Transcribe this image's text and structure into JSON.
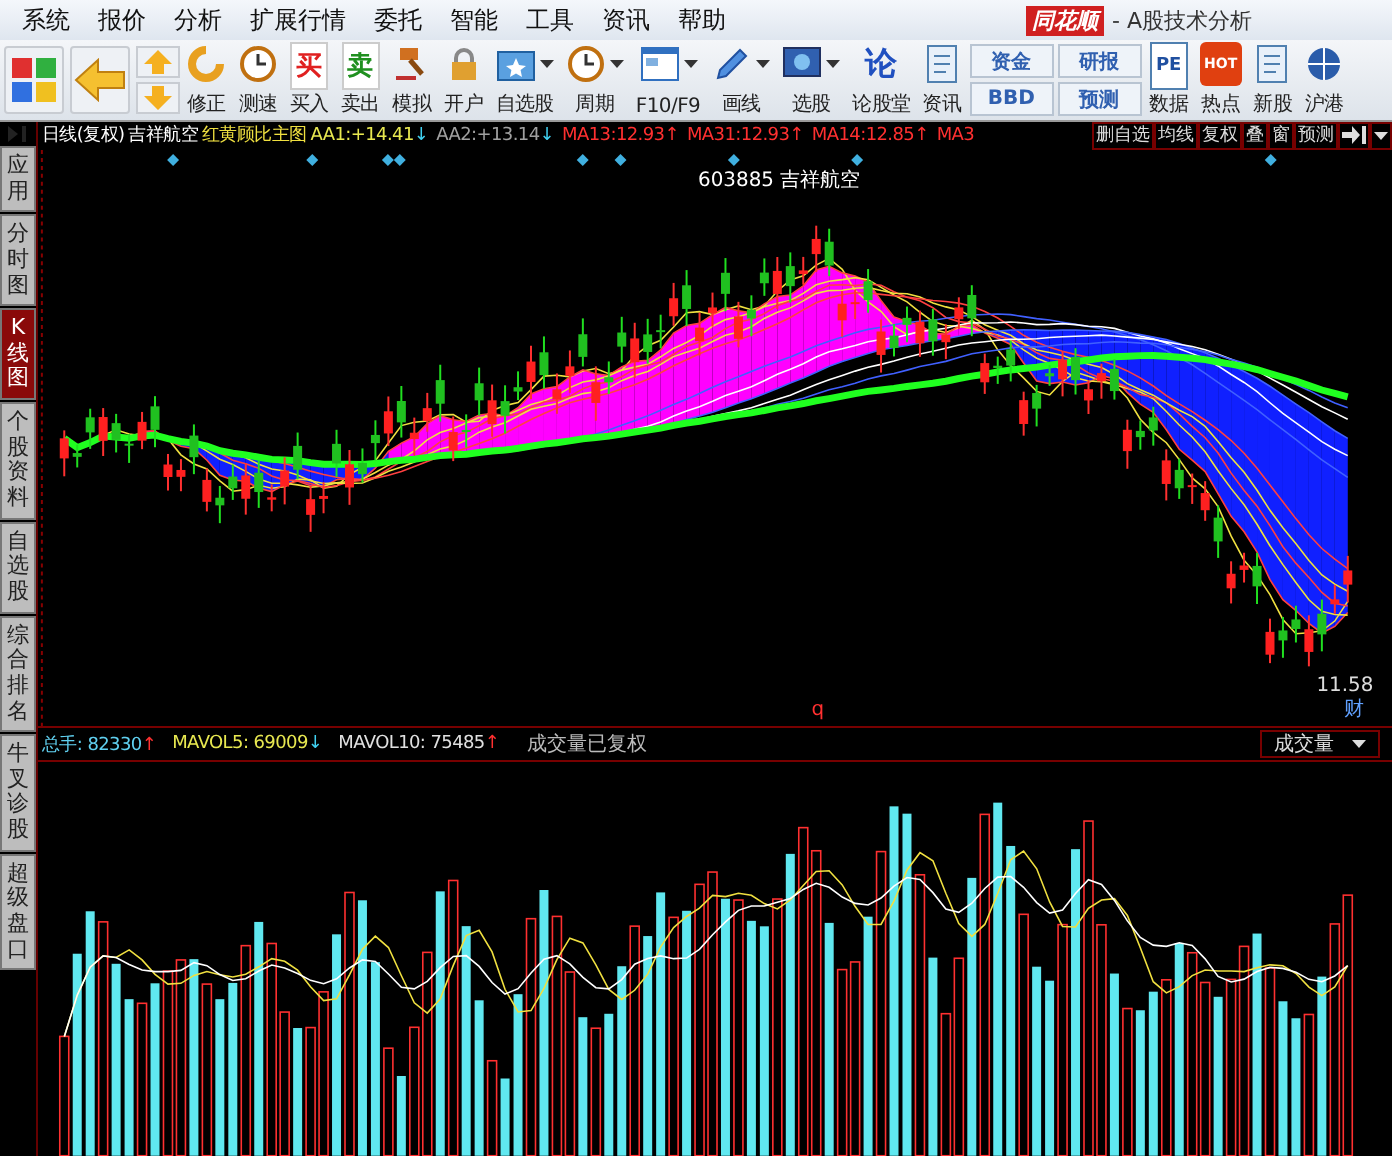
{
  "menu": [
    "系统",
    "报价",
    "分析",
    "扩展行情",
    "委托",
    "智能",
    "工具",
    "资讯",
    "帮助"
  ],
  "title": {
    "logo": "同花顺",
    "subtitle": "- A股技术分析"
  },
  "toolbar": [
    {
      "kind": "tile"
    },
    {
      "kind": "tile"
    },
    {
      "kind": "updown"
    },
    {
      "kind": "button",
      "label": "修正"
    },
    {
      "kind": "button",
      "label": "测速"
    },
    {
      "kind": "glyph",
      "glyph": "买",
      "label": "买入"
    },
    {
      "kind": "glyph",
      "glyph": "卖",
      "label": "卖出"
    },
    {
      "kind": "button",
      "label": "模拟"
    },
    {
      "kind": "button",
      "label": "开户"
    },
    {
      "kind": "dropdown",
      "label": "自选股"
    },
    {
      "kind": "dropdown",
      "label": "周期"
    },
    {
      "kind": "dropdown",
      "label": "F10/F9"
    },
    {
      "kind": "dropdown",
      "label": "画线"
    },
    {
      "kind": "dropdown",
      "label": "选股"
    },
    {
      "kind": "glyph",
      "glyph": "论",
      "label": "论股堂"
    },
    {
      "kind": "button",
      "label": "资讯"
    },
    {
      "kind": "pair",
      "top": "资金",
      "bottom": "BBD"
    },
    {
      "kind": "pair",
      "top": "研报",
      "bottom": "预测"
    },
    {
      "kind": "glyph",
      "glyph": "PE",
      "label": "数据"
    },
    {
      "kind": "glyph",
      "glyph": "HOT",
      "label": "热点"
    },
    {
      "kind": "button",
      "label": "新股"
    },
    {
      "kind": "button",
      "label": "沪港"
    }
  ],
  "sidebar": {
    "tabs": [
      {
        "label": "应用",
        "selected": false
      },
      {
        "label": "分时图",
        "selected": false
      },
      {
        "label": "K线图",
        "selected": true
      },
      {
        "label": "个股资料",
        "selected": false
      },
      {
        "label": "自选股",
        "selected": false
      },
      {
        "label": "综合排名",
        "selected": false
      },
      {
        "label": "牛叉诊股",
        "selected": false
      },
      {
        "label": "超级盘口",
        "selected": false
      }
    ]
  },
  "chart_header": {
    "period": "日线(复权)",
    "stock": "吉祥航空",
    "formula": "红黄顾比主图",
    "indicators": [
      {
        "label": "AA1:",
        "value": "+14.41",
        "arrow": {
          "glyph": "↓",
          "color": "#40d0f0"
        },
        "color": "#e8e850"
      },
      {
        "label": "AA2:",
        "value": "+13.14",
        "arrow": {
          "glyph": "↓",
          "color": "#40d0f0"
        },
        "color": "#a0a0a0"
      },
      {
        "label": "MA13:",
        "value": "12.93",
        "arrow": {
          "glyph": "↑",
          "color": "#ff3030"
        },
        "color": "#ff3030"
      },
      {
        "label": "MA31:",
        "value": "12.93",
        "arrow": {
          "glyph": "↑",
          "color": "#ff3030"
        },
        "color": "#ff3030"
      },
      {
        "label": "MA14:",
        "value": "12.85",
        "arrow": {
          "glyph": "↑",
          "color": "#ff3030"
        },
        "color": "#ff3030"
      },
      {
        "label": "MA3",
        "color": "#ff3030"
      }
    ],
    "buttons": [
      "删自选",
      "均线",
      "复权",
      "叠",
      "窗",
      "预测"
    ]
  },
  "chart": {
    "stock_label": "603885 吉祥航空",
    "low_label": "11.58",
    "marker": "财",
    "marker_2": "q"
  },
  "volume": {
    "indicators": [
      {
        "label": "总手:",
        "value": "82330",
        "arrow": {
          "glyph": "↑",
          "color": "#ff3030"
        },
        "color": "#60d0f0"
      },
      {
        "label": "MAVOL5:",
        "value": "69009",
        "arrow": {
          "glyph": "↓",
          "color": "#40d0f0"
        },
        "color": "#e8e850"
      },
      {
        "label": "MAVOL10:",
        "value": "75485",
        "arrow": {
          "glyph": "↑",
          "color": "#ff3030"
        },
        "color": "#e0e0e0"
      }
    ],
    "note": "成交量已复权",
    "selector": "成交量"
  }
}
